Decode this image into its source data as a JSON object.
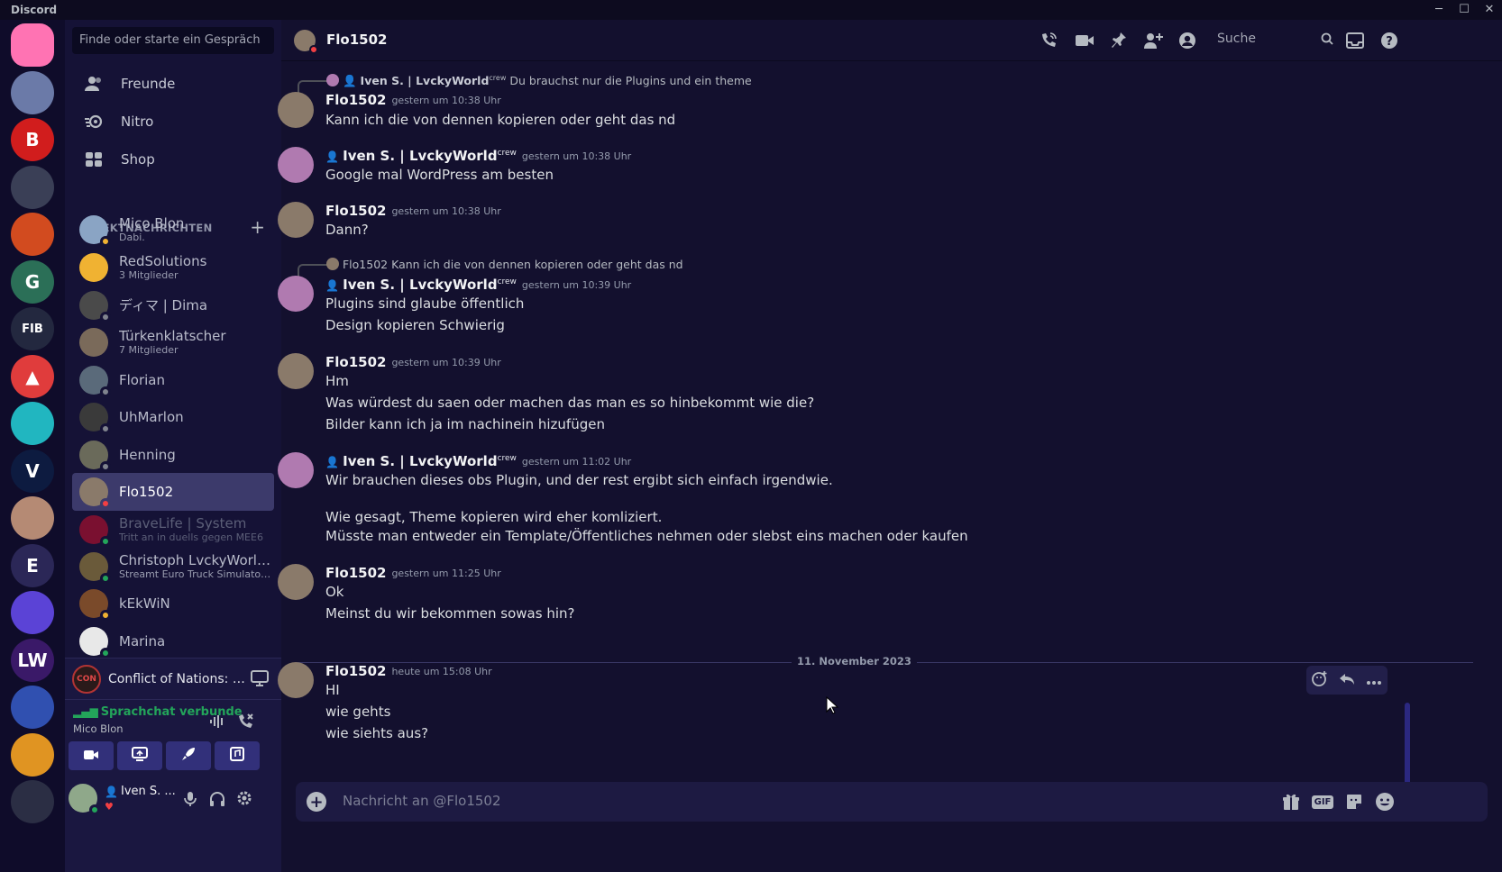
{
  "window": {
    "title": "Discord",
    "controls": [
      "─",
      "☐",
      "✕"
    ]
  },
  "servers": [
    {
      "name": "home",
      "label": "",
      "color": "#ff73b3"
    },
    {
      "name": "server-1",
      "label": "",
      "color": "#6b7aa8"
    },
    {
      "name": "server-2",
      "label": "B",
      "color": "#d11d1d"
    },
    {
      "name": "server-3",
      "label": "",
      "color": "#3a3f56"
    },
    {
      "name": "server-4",
      "label": "",
      "color": "#d24b1f"
    },
    {
      "name": "server-5",
      "label": "G",
      "color": "#2b6f57"
    },
    {
      "name": "server-6",
      "label": "FIB",
      "color": "#23283f"
    },
    {
      "name": "server-7",
      "label": "▲",
      "color": "#e03c3c"
    },
    {
      "name": "server-8",
      "label": "",
      "color": "#21b6c0"
    },
    {
      "name": "server-9",
      "label": "V",
      "color": "#0d1b40"
    },
    {
      "name": "server-10",
      "label": "",
      "color": "#b58a74"
    },
    {
      "name": "server-11",
      "label": "E",
      "color": "#2b2757"
    },
    {
      "name": "server-12",
      "label": "",
      "color": "#5b43d6"
    },
    {
      "name": "server-13",
      "label": "LW",
      "color": "#3a1968"
    },
    {
      "name": "server-14",
      "label": "",
      "color": "#3050b0"
    },
    {
      "name": "server-15",
      "label": "",
      "color": "#e09422"
    },
    {
      "name": "server-16",
      "label": "",
      "color": "#2b2e44"
    }
  ],
  "sidebar": {
    "search_placeholder": "Finde oder starte ein Gespräch",
    "nav": [
      {
        "label": "Freunde",
        "icon": "friends-icon"
      },
      {
        "label": "Nitro",
        "icon": "nitro-icon"
      },
      {
        "label": "Shop",
        "icon": "shop-icon"
      }
    ],
    "dm_header": "DIREKTNACHRICHTEN",
    "dms": [
      {
        "name": "Mico Blon",
        "sub": "Dabi.",
        "status": "idle",
        "color": "#8aa4c4"
      },
      {
        "name": "RedSolutions",
        "sub": "3 Mitglieder",
        "status": "",
        "color": "#f0b232"
      },
      {
        "name": "ディマ | Dima",
        "sub": "",
        "status": "offline",
        "color": "#4a4a4a"
      },
      {
        "name": "Türkenklatscher",
        "sub": "7 Mitglieder",
        "status": "",
        "color": "#7a6a5a"
      },
      {
        "name": "Florian",
        "sub": "",
        "status": "offline",
        "color": "#5a6a7a"
      },
      {
        "name": "UhMarlon",
        "sub": "",
        "status": "offline",
        "color": "#3a3a3a"
      },
      {
        "name": "Henning",
        "sub": "",
        "status": "offline",
        "color": "#6a6a5a"
      },
      {
        "name": "Flo1502",
        "sub": "",
        "status": "dnd",
        "color": "#8a7a6a"
      },
      {
        "name": "BraveLife | System",
        "sub": "Tritt an in duells gegen MEE6",
        "status": "online",
        "color": "#7a1030"
      },
      {
        "name": "Christoph LvckyWorld...",
        "sub": "Streamt Euro Truck Simulator...",
        "status": "online",
        "color": "#6a5a3a"
      },
      {
        "name": "kEkWiN",
        "sub": "",
        "status": "idle",
        "color": "#7a4a2a"
      },
      {
        "name": "Marina",
        "sub": "",
        "status": "online",
        "color": "#e8e8e8"
      }
    ],
    "activity": {
      "badge": "CON",
      "title": "Conflict of Nations: Wo..."
    },
    "voice": {
      "status": "Sprachchat verbunde",
      "channel": "Mico Blon"
    },
    "user": {
      "name": "Iven S. ..."
    }
  },
  "chat": {
    "title": "Flo1502",
    "search_placeholder": "Suche",
    "composer_placeholder": "Nachricht an @Flo1502",
    "gif_label": "GIF",
    "date_divider": "11. November 2023",
    "messages": [
      {
        "author": "Flo1502",
        "crew": "",
        "ts": "gestern um 10:38 Uhr",
        "reply": {
          "author": "Iven S. | LvckyWorld",
          "crew": "crew",
          "text": "Du brauchst nur die Plugins und ein theme"
        },
        "lines": [
          "Kann ich die von dennen kopieren oder geht das nd"
        ]
      },
      {
        "author": "Iven S. | LvckyWorld",
        "crew": "crew",
        "ts": "gestern um 10:38 Uhr",
        "lines": [
          "Google mal WordPress am besten"
        ]
      },
      {
        "author": "Flo1502",
        "crew": "",
        "ts": "gestern um 10:38 Uhr",
        "lines": [
          "Dann?"
        ]
      },
      {
        "author": "Iven S. | LvckyWorld",
        "crew": "crew",
        "ts": "gestern um 10:39 Uhr",
        "reply": {
          "author": "Flo1502",
          "crew": "",
          "text": "Kann ich die von dennen kopieren oder geht das nd"
        },
        "lines": [
          "Plugins sind glaube öffentlich",
          "Design kopieren Schwierig"
        ]
      },
      {
        "author": "Flo1502",
        "crew": "",
        "ts": "gestern um 10:39 Uhr",
        "lines": [
          "Hm",
          "Was würdest du saen oder machen das man es so hinbekommt wie die?",
          "Bilder kann ich ja im nachinein hizufügen"
        ]
      },
      {
        "author": "Iven S. | LvckyWorld",
        "crew": "crew",
        "ts": "gestern um 11:02 Uhr",
        "lines": [
          "Wir brauchen dieses obs Plugin, und der rest ergibt sich einfach irgendwie.",
          "Wie gesagt, Theme kopieren wird eher komliziert.",
          "Müsste man entweder ein Template/Öffentliches nehmen oder slebst eins machen oder kaufen"
        ]
      },
      {
        "author": "Flo1502",
        "crew": "",
        "ts": "gestern um 11:25 Uhr",
        "lines": [
          "Ok",
          "Meinst du wir bekommen sowas hin?"
        ]
      },
      {
        "author": "Flo1502",
        "crew": "",
        "ts": "heute um 15:08 Uhr",
        "lines": [
          "HI",
          "wie gehts",
          "wie siehts aus?"
        ]
      }
    ]
  },
  "colors": {
    "online": "#23a55a",
    "idle": "#f0b232",
    "dnd": "#f23f43",
    "offline": "#80848e",
    "accent": "#5865f2"
  }
}
